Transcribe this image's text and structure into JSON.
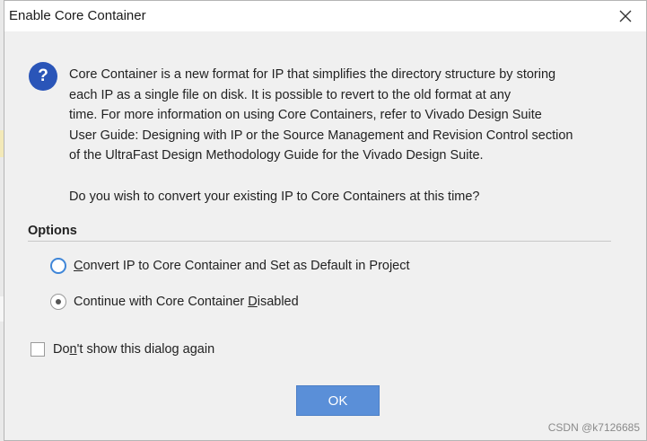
{
  "dialog": {
    "title": "Enable Core Container",
    "close_glyph": "×"
  },
  "icons": {
    "question": "?",
    "close": "close-icon"
  },
  "message": {
    "lines": [
      "Core Container is a new format for IP that simplifies the directory structure by storing",
      "each IP as a single file on disk. It is possible to revert to the old format at any",
      "time. For more information on using Core Containers, refer to Vivado Design Suite",
      "User Guide: Designing with IP or the Source Management and Revision Control section",
      "of the UltraFast Design Methodology Guide for the Vivado Design Suite."
    ],
    "question": "Do you wish to convert your existing IP to Core Containers at this time?"
  },
  "options": {
    "header": "Options",
    "convert": {
      "mnemonic": "C",
      "rest": "onvert IP to Core Container and Set as Default in Project",
      "selected": false
    },
    "disable": {
      "before": "Continue with Core Container ",
      "mnemonic": "D",
      "after": "isabled",
      "selected": true
    }
  },
  "dont_show": {
    "before": "Do",
    "mnemonic": "n",
    "after": "'t show this dialog again",
    "checked": false
  },
  "ok_label": "OK",
  "watermark": "CSDN @k7126685",
  "colors": {
    "accent": "#5a8fd8",
    "icon_blue": "#2a55b8",
    "focus_ring": "#3f86d8"
  }
}
